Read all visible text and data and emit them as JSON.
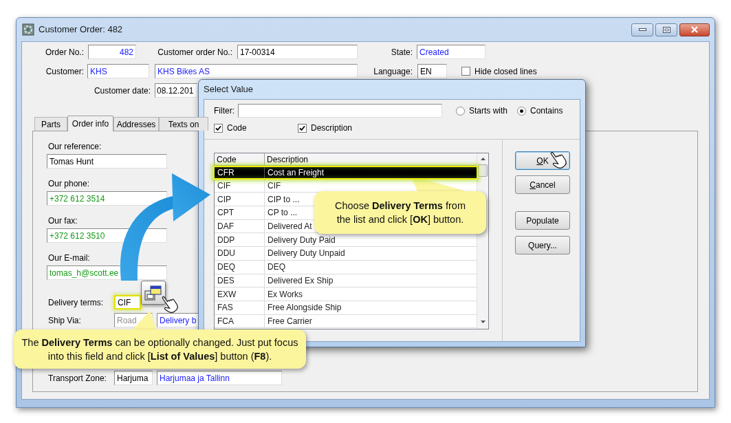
{
  "window": {
    "title": "Customer Order: 482"
  },
  "header": {
    "order_no": {
      "label": "Order No.:",
      "value": "482"
    },
    "customer_order_no": {
      "label": "Customer order No.:",
      "value": "17-00314"
    },
    "state": {
      "label": "State:",
      "value": "Created"
    },
    "customer": {
      "label": "Customer:",
      "code": "KHS",
      "name": "KHS Bikes AS"
    },
    "language": {
      "label": "Language:",
      "value": "EN"
    },
    "hide_closed_lines": {
      "label": "Hide closed lines",
      "checked": false
    },
    "customer_date": {
      "label": "Customer date:",
      "value": "08.12.201"
    }
  },
  "tabs": [
    {
      "label": "Parts",
      "selected": false
    },
    {
      "label": "Order info",
      "selected": true
    },
    {
      "label": "Addresses",
      "selected": false
    },
    {
      "label": "Texts on",
      "selected": false
    }
  ],
  "order_info": {
    "fields": [
      {
        "label": "Our reference:",
        "value": "Tomas Hunt",
        "kind": "plain"
      },
      {
        "label": "Our phone:",
        "value": "+372 612 3514",
        "kind": "contact"
      },
      {
        "label": "Our fax:",
        "value": "+372 612 3510",
        "kind": "contact"
      },
      {
        "label": "Our E-mail:",
        "value": "tomas_h@scott.ee",
        "kind": "contact"
      }
    ],
    "delivery_terms": {
      "label": "Delivery terms:",
      "code": "CIF",
      "highlighted": true
    },
    "ship_via": {
      "label": "Ship Via:",
      "code": "Road",
      "description": "Delivery b"
    },
    "transport_zone": {
      "label": "Transport Zone:",
      "code": "Harjuma",
      "description": "Harjumaa ja Tallinn"
    }
  },
  "dialog": {
    "title": "Select Value",
    "filter": {
      "label": "Filter:"
    },
    "match_options": [
      {
        "label": "Starts with",
        "selected": false
      },
      {
        "label": "Contains",
        "selected": true
      }
    ],
    "search_in": [
      {
        "label": "Code",
        "checked": true
      },
      {
        "label": "Description",
        "checked": true
      }
    ],
    "table": {
      "columns": [
        "Code",
        "Description"
      ],
      "rows": [
        {
          "code": "CFR",
          "description": "Cost an Freight",
          "selected": true
        },
        {
          "code": "CIF",
          "description": "CIF",
          "selected": false
        },
        {
          "code": "CIP",
          "description": "CIP to ...",
          "selected": false
        },
        {
          "code": "CPT",
          "description": "CP to ...",
          "selected": false
        },
        {
          "code": "DAF",
          "description": "Delivered At",
          "selected": false
        },
        {
          "code": "DDP",
          "description": "Delivery Duty Paid",
          "selected": false
        },
        {
          "code": "DDU",
          "description": "Delivery Duty Unpaid",
          "selected": false
        },
        {
          "code": "DEQ",
          "description": "DEQ",
          "selected": false
        },
        {
          "code": "DES",
          "description": "Delivered Ex Ship",
          "selected": false
        },
        {
          "code": "EXW",
          "description": "Ex Works",
          "selected": false
        },
        {
          "code": "FAS",
          "description": "Free Alongside Ship",
          "selected": false
        },
        {
          "code": "FCA",
          "description": "Free Carrier",
          "selected": false
        }
      ]
    },
    "buttons": [
      {
        "label": "OK",
        "focused": true,
        "mnemonic": true
      },
      {
        "label": "Cancel",
        "focused": false,
        "mnemonic": true
      },
      {
        "label": "Populate",
        "focused": false,
        "mnemonic": false
      },
      {
        "label": "Query...",
        "focused": false,
        "mnemonic": false
      }
    ]
  },
  "callouts": [
    {
      "text": "Choose **Delivery Terms** from the list and click [**OK**] button."
    },
    {
      "text": "The **Delivery Terms** can be optionally changed.  Just put focus into this field and click [**List of Values**] button (**F8**)."
    }
  ]
}
